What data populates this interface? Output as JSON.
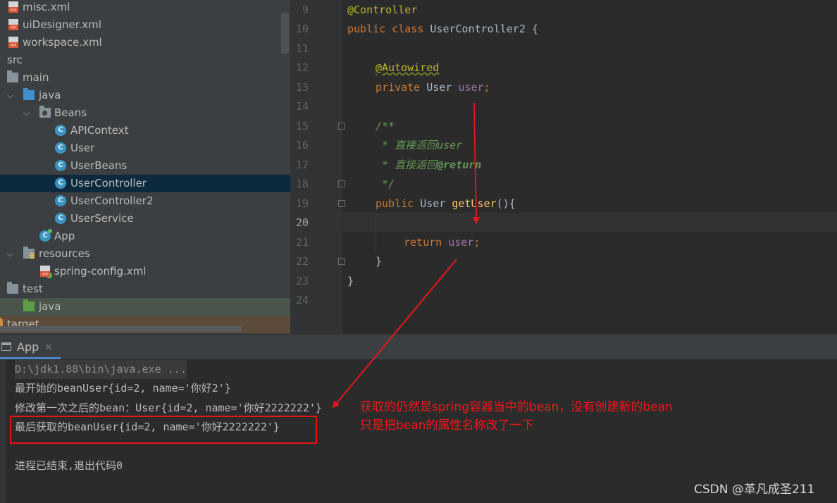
{
  "project_tree": {
    "items": [
      {
        "label": "misc.xml",
        "icon": "xml-file-icon"
      },
      {
        "label": "uiDesigner.xml",
        "icon": "xml-file-icon"
      },
      {
        "label": "workspace.xml",
        "icon": "xml-file-icon"
      },
      {
        "label": "src",
        "icon": "folder-icon"
      },
      {
        "label": "main",
        "icon": "folder-icon"
      },
      {
        "label": "java",
        "icon": "source-folder-icon",
        "expanded": true
      },
      {
        "label": "Beans",
        "icon": "package-icon",
        "expanded": true
      },
      {
        "label": "APIContext",
        "icon": "class-icon"
      },
      {
        "label": "User",
        "icon": "class-icon"
      },
      {
        "label": "UserBeans",
        "icon": "class-icon"
      },
      {
        "label": "UserController",
        "icon": "class-icon",
        "selected": true
      },
      {
        "label": "UserController2",
        "icon": "class-icon"
      },
      {
        "label": "UserService",
        "icon": "class-icon"
      },
      {
        "label": "App",
        "icon": "runnable-class-icon"
      },
      {
        "label": "resources",
        "icon": "resources-folder-icon",
        "expanded": true
      },
      {
        "label": "spring-config.xml",
        "icon": "spring-xml-icon"
      },
      {
        "label": "test",
        "icon": "folder-icon"
      },
      {
        "label": "java",
        "icon": "test-source-folder-icon"
      },
      {
        "label": "target",
        "icon": "excluded-folder-icon"
      }
    ],
    "class_icon_letter": "C"
  },
  "editor": {
    "line_numbers": [
      "9",
      "10",
      "11",
      "12",
      "13",
      "14",
      "15",
      "16",
      "17",
      "18",
      "19",
      "20",
      "21",
      "22",
      "23",
      "24"
    ],
    "current_line": "20",
    "code": {
      "l9_annotation": "@Controller",
      "l10_kw": "public class",
      "l10_rest": " UserController2 {",
      "l12_annotation": "@Autowired",
      "l13_kw": "private",
      "l13_type": " User ",
      "l13_field": "user",
      "l13_semi": ";",
      "l15_doc": "/**",
      "l16_doc": " * 直接返回user",
      "l17_doc_pre": " * 直接返回",
      "l17_doc_tag": "@return",
      "l18_doc": " */",
      "l19_kw": "public",
      "l19_type": " User ",
      "l19_method": "getUser",
      "l19_rest": "(){",
      "l21_kw": "return",
      "l21_field": "user",
      "l21_semi": ";",
      "l22_brace": "}",
      "l23_brace": "}"
    }
  },
  "run_panel": {
    "tab_label": "App",
    "close_glyph": "×",
    "lines": [
      "D:\\jdk1.88\\bin\\java.exe ...",
      "最开始的beanUser{id=2, name='你好2'}",
      "修改第一次之后的bean：User{id=2, name='你好2222222'}",
      "最后获取的beanUser{id=2, name='你好2222222'}",
      "",
      "进程已结束,退出代码0"
    ]
  },
  "annotation_note": {
    "line1": "获取的仍然是spring容器当中的bean，没有创建新的bean",
    "line2": "只是把bean的属性名称改了一下",
    "color": "#f0171a"
  },
  "watermark": "CSDN @革凡成圣211"
}
